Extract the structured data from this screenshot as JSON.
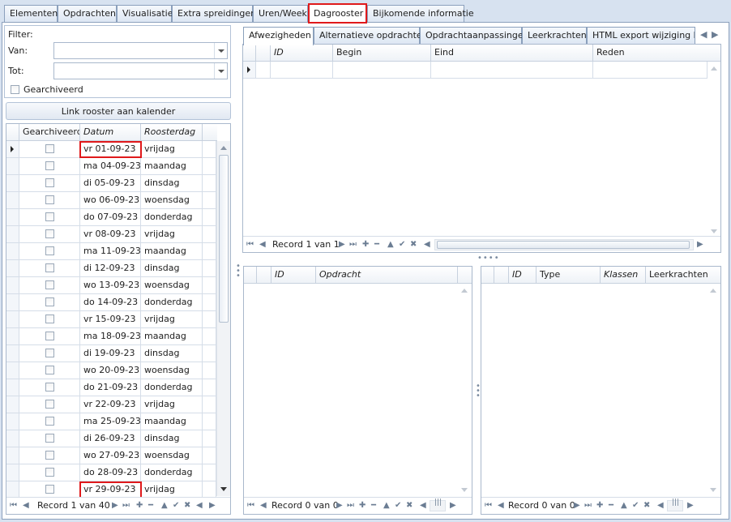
{
  "main_tabs": [
    {
      "label": "Elementen"
    },
    {
      "label": "Opdrachten"
    },
    {
      "label": "Visualisatie"
    },
    {
      "label": "Extra spreidingen"
    },
    {
      "label": "Uren/Week"
    },
    {
      "label": "Dagrooster",
      "active": true
    },
    {
      "label": "Bijkomende informatie"
    }
  ],
  "filter": {
    "title": "Filter:",
    "van_label": "Van:",
    "van_value": "",
    "tot_label": "Tot:",
    "tot_value": "",
    "archived_label": "Gearchiveerd",
    "archived_checked": false
  },
  "link_button": "Link rooster aan kalender",
  "left_grid": {
    "columns": [
      "Gearchiveerd",
      "Datum",
      "Roosterdag"
    ],
    "rows": [
      {
        "datum": "vr 01-09-23",
        "dag": "vrijdag"
      },
      {
        "datum": "ma 04-09-23",
        "dag": "maandag"
      },
      {
        "datum": "di 05-09-23",
        "dag": "dinsdag"
      },
      {
        "datum": "wo 06-09-23",
        "dag": "woensdag"
      },
      {
        "datum": "do 07-09-23",
        "dag": "donderdag"
      },
      {
        "datum": "vr 08-09-23",
        "dag": "vrijdag"
      },
      {
        "datum": "ma 11-09-23",
        "dag": "maandag"
      },
      {
        "datum": "di 12-09-23",
        "dag": "dinsdag"
      },
      {
        "datum": "wo 13-09-23",
        "dag": "woensdag"
      },
      {
        "datum": "do 14-09-23",
        "dag": "donderdag"
      },
      {
        "datum": "vr 15-09-23",
        "dag": "vrijdag"
      },
      {
        "datum": "ma 18-09-23",
        "dag": "maandag"
      },
      {
        "datum": "di 19-09-23",
        "dag": "dinsdag"
      },
      {
        "datum": "wo 20-09-23",
        "dag": "woensdag"
      },
      {
        "datum": "do 21-09-23",
        "dag": "donderdag"
      },
      {
        "datum": "vr 22-09-23",
        "dag": "vrijdag"
      },
      {
        "datum": "ma 25-09-23",
        "dag": "maandag"
      },
      {
        "datum": "di 26-09-23",
        "dag": "dinsdag"
      },
      {
        "datum": "wo 27-09-23",
        "dag": "woensdag"
      },
      {
        "datum": "do 28-09-23",
        "dag": "donderdag"
      },
      {
        "datum": "vr 29-09-23",
        "dag": "vrijdag"
      }
    ],
    "record_text": "Record 1 van 40"
  },
  "sub_tabs": [
    {
      "label": "Afwezigheden",
      "active": true
    },
    {
      "label": "Alternatieve opdrachten"
    },
    {
      "label": "Opdrachtaanpassingen"
    },
    {
      "label": "Leerkrachten"
    },
    {
      "label": "HTML export wijziging klas"
    }
  ],
  "absence_grid": {
    "columns": [
      "ID",
      "Begin",
      "Eind",
      "Reden"
    ],
    "record_text": "Record 1 van 1"
  },
  "assignment_grid": {
    "columns": [
      "ID",
      "Opdracht"
    ],
    "record_text": "Record 0 van 0"
  },
  "type_grid": {
    "columns": [
      "ID",
      "Type",
      "Klassen",
      "Leerkrachten"
    ],
    "record_text": "Record 0 van 0"
  },
  "nav_icons": [
    "first-icon",
    "prev-icon",
    "next-icon",
    "last-icon",
    "add-icon",
    "remove-icon",
    "up-icon",
    "save-icon",
    "cancel-icon"
  ],
  "colors": {
    "highlight": "#e0191b",
    "border": "#8ba0bc",
    "background": "#d7e2f0"
  }
}
